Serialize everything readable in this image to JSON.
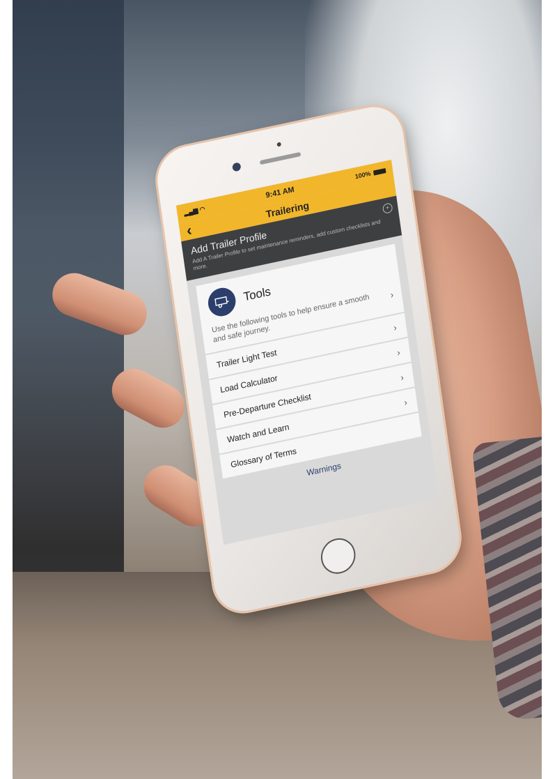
{
  "status_bar": {
    "time": "9:41 AM",
    "battery": "100%"
  },
  "nav": {
    "title": "Trailering",
    "back_icon": "chevron-left-icon"
  },
  "banner": {
    "title": "Add Trailer Profile",
    "subtitle": "Add A Trailer Profile to set maintenance reminders, add custom checklists and more.",
    "action_icon": "add-circle-icon"
  },
  "tools_card": {
    "title": "Tools",
    "description": "Use the following tools to help ensure a smooth and safe journey.",
    "icon": "trailer-icon",
    "icon_color": "#2c3e6b"
  },
  "tool_items": [
    {
      "label": "Trailer Light Test"
    },
    {
      "label": "Load Calculator"
    },
    {
      "label": "Pre-Departure Checklist"
    },
    {
      "label": "Watch and Learn"
    },
    {
      "label": "Glossary of Terms"
    }
  ],
  "footer": {
    "warnings_label": "Warnings"
  },
  "colors": {
    "accent": "#f2b62b",
    "banner": "#3e3f41",
    "link": "#2c3e6b"
  }
}
